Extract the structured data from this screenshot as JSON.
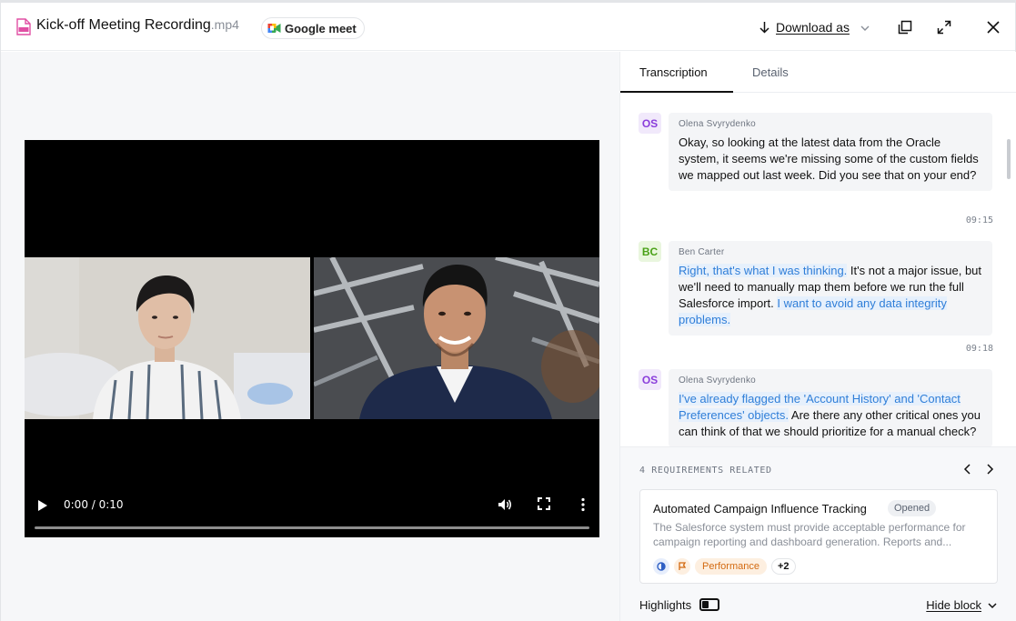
{
  "header": {
    "file_name": "Kick-off Meeting Recording",
    "file_ext": ".mp4",
    "source_badge": "Google meet",
    "download_label": "Download as",
    "icons": {
      "file": "mp4-file-icon",
      "meet": "google-meet-icon",
      "download": "arrow-down-icon",
      "dropdown": "chevron-down-icon",
      "copy": "copy-icon",
      "expand": "expand-icon",
      "close": "close-icon"
    }
  },
  "video": {
    "time": "0:00 / 0:10",
    "progress": 0,
    "icons": [
      "play-icon",
      "volume-icon",
      "fullscreen-icon",
      "more-vertical-icon"
    ]
  },
  "tabs": [
    {
      "label": "Transcription",
      "active": true
    },
    {
      "label": "Details",
      "active": false
    }
  ],
  "transcript": [
    {
      "initials": "OS",
      "speaker": "Olena Svyrydenko",
      "segments": [
        {
          "text": "Okay, so looking at the latest data from the Oracle system, it seems we're missing some of the custom fields we mapped out last week. Did you see that on your end?",
          "highlight": false
        }
      ],
      "time": "09:15"
    },
    {
      "initials": "BC",
      "speaker": "Ben Carter",
      "segments": [
        {
          "text": "Right, that's what I was thinking.",
          "highlight": true
        },
        {
          "text": " It's not a major issue, but we'll need to manually map them before we run the full Salesforce import. ",
          "highlight": false
        },
        {
          "text": "I want to avoid any data integrity problems.",
          "highlight": true
        }
      ],
      "time": "09:18"
    },
    {
      "initials": "OS",
      "speaker": "Olena Svyrydenko",
      "segments": [
        {
          "text": "I've already flagged the 'Account History' and 'Contact Preferences' objects.",
          "highlight": true
        },
        {
          "text": " Are there any other critical ones you can think of that we should prioritize for a manual check?",
          "highlight": false
        }
      ],
      "time": ""
    }
  ],
  "requirements": {
    "count_label": "4 REQUIREMENTS RELATED",
    "card": {
      "title": "Automated Campaign Influence Tracking",
      "status": "Opened",
      "description": "The Salesforce system must provide acceptable performance for campaign reporting and dashboard generation. Reports and...",
      "tag_label": "Performance",
      "more_label": "+2"
    }
  },
  "footer": {
    "highlights_label": "Highlights",
    "hide_block_label": "Hide block"
  },
  "colors": {
    "highlight_text": "#2f7ed8",
    "highlight_bg": "#e6f0fc",
    "avatar_purple": "#8a3ddb",
    "avatar_green": "#4aa118",
    "performance_tag": "#d36a11"
  }
}
